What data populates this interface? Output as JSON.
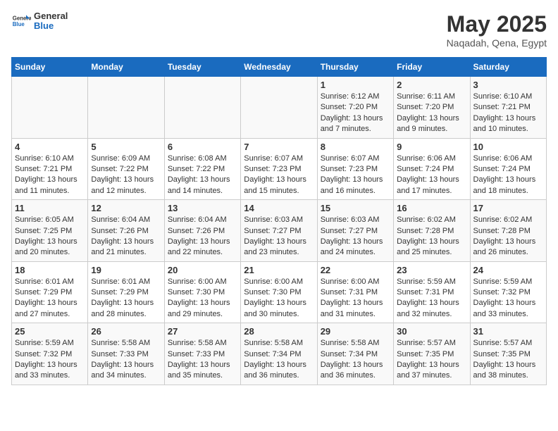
{
  "header": {
    "logo_general": "General",
    "logo_blue": "Blue",
    "month": "May 2025",
    "location": "Naqadah, Qena, Egypt"
  },
  "days_of_week": [
    "Sunday",
    "Monday",
    "Tuesday",
    "Wednesday",
    "Thursday",
    "Friday",
    "Saturday"
  ],
  "weeks": [
    [
      {
        "day": "",
        "info": ""
      },
      {
        "day": "",
        "info": ""
      },
      {
        "day": "",
        "info": ""
      },
      {
        "day": "",
        "info": ""
      },
      {
        "day": "1",
        "info": "Sunrise: 6:12 AM\nSunset: 7:20 PM\nDaylight: 13 hours and 7 minutes."
      },
      {
        "day": "2",
        "info": "Sunrise: 6:11 AM\nSunset: 7:20 PM\nDaylight: 13 hours and 9 minutes."
      },
      {
        "day": "3",
        "info": "Sunrise: 6:10 AM\nSunset: 7:21 PM\nDaylight: 13 hours and 10 minutes."
      }
    ],
    [
      {
        "day": "4",
        "info": "Sunrise: 6:10 AM\nSunset: 7:21 PM\nDaylight: 13 hours and 11 minutes."
      },
      {
        "day": "5",
        "info": "Sunrise: 6:09 AM\nSunset: 7:22 PM\nDaylight: 13 hours and 12 minutes."
      },
      {
        "day": "6",
        "info": "Sunrise: 6:08 AM\nSunset: 7:22 PM\nDaylight: 13 hours and 14 minutes."
      },
      {
        "day": "7",
        "info": "Sunrise: 6:07 AM\nSunset: 7:23 PM\nDaylight: 13 hours and 15 minutes."
      },
      {
        "day": "8",
        "info": "Sunrise: 6:07 AM\nSunset: 7:23 PM\nDaylight: 13 hours and 16 minutes."
      },
      {
        "day": "9",
        "info": "Sunrise: 6:06 AM\nSunset: 7:24 PM\nDaylight: 13 hours and 17 minutes."
      },
      {
        "day": "10",
        "info": "Sunrise: 6:06 AM\nSunset: 7:24 PM\nDaylight: 13 hours and 18 minutes."
      }
    ],
    [
      {
        "day": "11",
        "info": "Sunrise: 6:05 AM\nSunset: 7:25 PM\nDaylight: 13 hours and 20 minutes."
      },
      {
        "day": "12",
        "info": "Sunrise: 6:04 AM\nSunset: 7:26 PM\nDaylight: 13 hours and 21 minutes."
      },
      {
        "day": "13",
        "info": "Sunrise: 6:04 AM\nSunset: 7:26 PM\nDaylight: 13 hours and 22 minutes."
      },
      {
        "day": "14",
        "info": "Sunrise: 6:03 AM\nSunset: 7:27 PM\nDaylight: 13 hours and 23 minutes."
      },
      {
        "day": "15",
        "info": "Sunrise: 6:03 AM\nSunset: 7:27 PM\nDaylight: 13 hours and 24 minutes."
      },
      {
        "day": "16",
        "info": "Sunrise: 6:02 AM\nSunset: 7:28 PM\nDaylight: 13 hours and 25 minutes."
      },
      {
        "day": "17",
        "info": "Sunrise: 6:02 AM\nSunset: 7:28 PM\nDaylight: 13 hours and 26 minutes."
      }
    ],
    [
      {
        "day": "18",
        "info": "Sunrise: 6:01 AM\nSunset: 7:29 PM\nDaylight: 13 hours and 27 minutes."
      },
      {
        "day": "19",
        "info": "Sunrise: 6:01 AM\nSunset: 7:29 PM\nDaylight: 13 hours and 28 minutes."
      },
      {
        "day": "20",
        "info": "Sunrise: 6:00 AM\nSunset: 7:30 PM\nDaylight: 13 hours and 29 minutes."
      },
      {
        "day": "21",
        "info": "Sunrise: 6:00 AM\nSunset: 7:30 PM\nDaylight: 13 hours and 30 minutes."
      },
      {
        "day": "22",
        "info": "Sunrise: 6:00 AM\nSunset: 7:31 PM\nDaylight: 13 hours and 31 minutes."
      },
      {
        "day": "23",
        "info": "Sunrise: 5:59 AM\nSunset: 7:31 PM\nDaylight: 13 hours and 32 minutes."
      },
      {
        "day": "24",
        "info": "Sunrise: 5:59 AM\nSunset: 7:32 PM\nDaylight: 13 hours and 33 minutes."
      }
    ],
    [
      {
        "day": "25",
        "info": "Sunrise: 5:59 AM\nSunset: 7:32 PM\nDaylight: 13 hours and 33 minutes."
      },
      {
        "day": "26",
        "info": "Sunrise: 5:58 AM\nSunset: 7:33 PM\nDaylight: 13 hours and 34 minutes."
      },
      {
        "day": "27",
        "info": "Sunrise: 5:58 AM\nSunset: 7:33 PM\nDaylight: 13 hours and 35 minutes."
      },
      {
        "day": "28",
        "info": "Sunrise: 5:58 AM\nSunset: 7:34 PM\nDaylight: 13 hours and 36 minutes."
      },
      {
        "day": "29",
        "info": "Sunrise: 5:58 AM\nSunset: 7:34 PM\nDaylight: 13 hours and 36 minutes."
      },
      {
        "day": "30",
        "info": "Sunrise: 5:57 AM\nSunset: 7:35 PM\nDaylight: 13 hours and 37 minutes."
      },
      {
        "day": "31",
        "info": "Sunrise: 5:57 AM\nSunset: 7:35 PM\nDaylight: 13 hours and 38 minutes."
      }
    ]
  ]
}
